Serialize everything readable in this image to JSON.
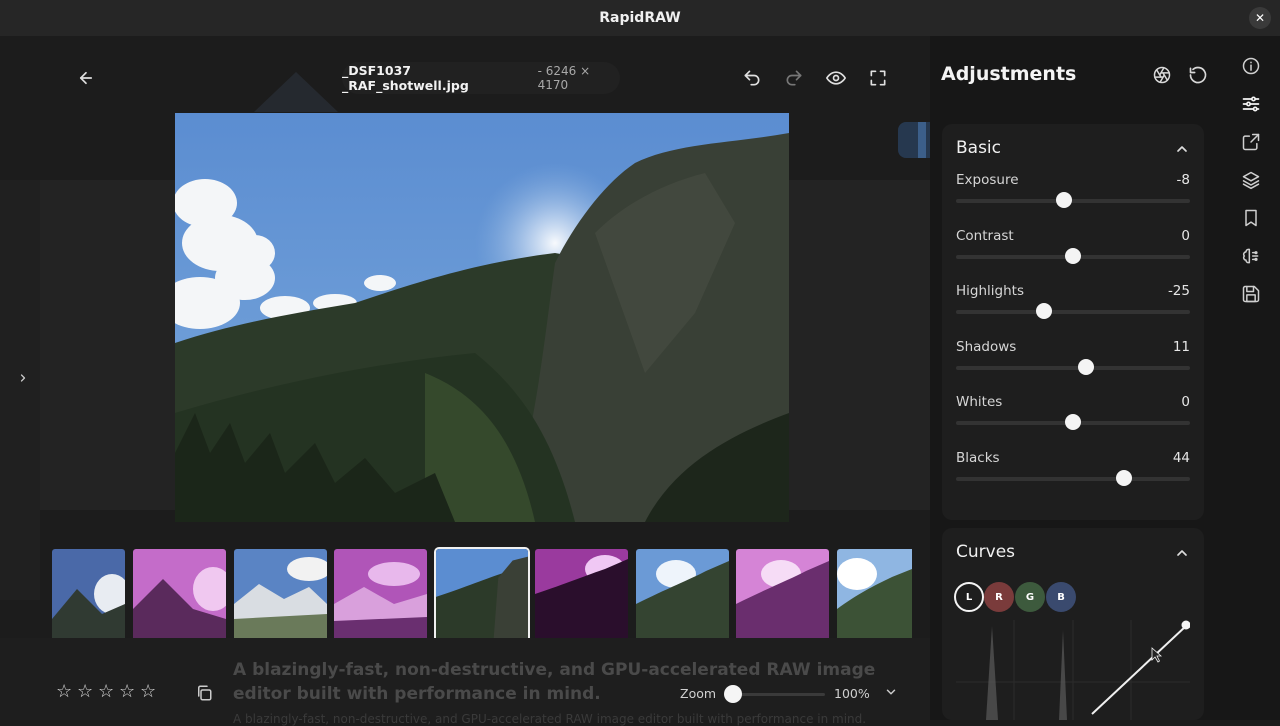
{
  "window": {
    "title": "RapidRAW"
  },
  "toolbar": {
    "file_name": "_DSF1037 _RAF_shotwell.jpg",
    "file_dims": "- 6246 × 4170"
  },
  "panel": {
    "title": "Adjustments",
    "basic": {
      "title": "Basic",
      "sliders": [
        {
          "label": "Exposure",
          "value": "-8",
          "level": -0.08
        },
        {
          "label": "Contrast",
          "value": "0",
          "level": 0
        },
        {
          "label": "Highlights",
          "value": "-25",
          "level": -0.25
        },
        {
          "label": "Shadows",
          "value": "11",
          "level": 0.11
        },
        {
          "label": "Whites",
          "value": "0",
          "level": 0
        },
        {
          "label": "Blacks",
          "value": "44",
          "level": 0.44
        }
      ]
    },
    "curves": {
      "title": "Curves",
      "channels": [
        {
          "label": "L",
          "color": "#1e1e1e"
        },
        {
          "label": "R",
          "color": "#7a3b3b"
        },
        {
          "label": "G",
          "color": "#3d5a3d"
        },
        {
          "label": "B",
          "color": "#3a4a6e"
        }
      ]
    }
  },
  "footer": {
    "tagline": "A blazingly-fast, non-destructive, and GPU-accelerated RAW image editor built with performance in mind.",
    "tagline_sub": "A blazingly-fast, non-destructive, and GPU-accelerated RAW image editor built with performance in mind.",
    "zoom_label": "Zoom",
    "zoom_value": "100%",
    "zoom_level": 1.0,
    "rating": 0
  },
  "colors": {
    "accent": "#f4f4f4",
    "panel_bg": "#171717",
    "card_bg": "#1e1e1e"
  },
  "icons": {
    "back": "arrow-left-icon",
    "undo": "undo-icon",
    "redo": "redo-icon",
    "preview": "eye-icon",
    "fullscreen": "fullscreen-icon",
    "aperture": "aperture-icon",
    "reset": "reset-icon",
    "rail": [
      "info-icon",
      "sliders-icon",
      "export-icon",
      "layers-icon",
      "bookmark-icon",
      "ai-icon",
      "save-icon"
    ]
  }
}
